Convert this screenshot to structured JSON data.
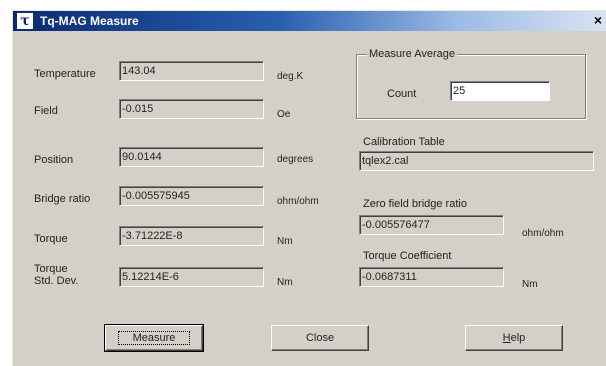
{
  "window": {
    "title": "Tq-MAG Measure",
    "icon": "tau-icon"
  },
  "fields": [
    {
      "label": "Temperature",
      "value": "143.04",
      "unit": "deg.K"
    },
    {
      "label": "Field",
      "value": "-0.015",
      "unit": "Oe"
    },
    {
      "label": "Position",
      "value": "90.0144",
      "unit": "degrees"
    },
    {
      "label": "Bridge ratio",
      "value": "-0.005575945",
      "unit": "ohm/ohm"
    },
    {
      "label": "Torque",
      "value": "-3.71222E-8",
      "unit": "Nm"
    },
    {
      "label_line1": "Torque",
      "label_line2": "Std. Dev.",
      "value": "5.12214E-6",
      "unit": "Nm"
    }
  ],
  "measure_average": {
    "title": "Measure Average",
    "count_label": "Count",
    "count_value": "25"
  },
  "calibration": {
    "label": "Calibration Table",
    "value": "tqlex2.cal"
  },
  "zero_field": {
    "label": "Zero field bridge ratio",
    "value": "-0.005576477",
    "unit": "ohm/ohm"
  },
  "torque_coefficient": {
    "label": "Torque Coefficient",
    "value": "-0.0687311",
    "unit": "Nm"
  },
  "buttons": {
    "measure": "Measure",
    "close": "Close",
    "help_first": "H",
    "help_rest": "elp"
  }
}
